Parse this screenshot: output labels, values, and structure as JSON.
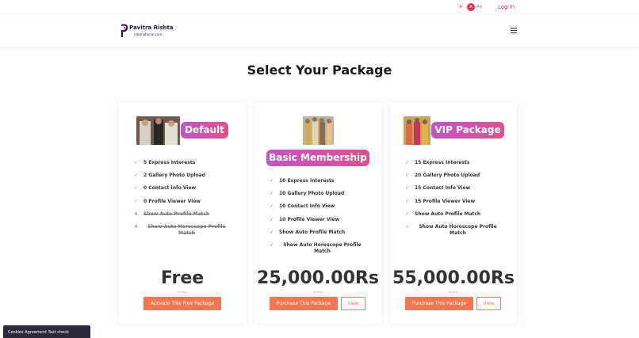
{
  "topbar": {
    "font_decrease": "A-",
    "font_normal": "A",
    "font_increase": "A+",
    "login": "Log In"
  },
  "header": {
    "logo_title": "Pavitra Rishta",
    "logo_subtitle": "international.com"
  },
  "page_title": "Select Your Package",
  "packages": [
    {
      "badge": "Default",
      "features": [
        {
          "text": "5 Express Interests",
          "included": true
        },
        {
          "text": "2 Gallery Photo Upload",
          "included": true
        },
        {
          "text": "0 Contact Info View",
          "included": true
        },
        {
          "text": "0 Profile Viewer View",
          "included": true
        },
        {
          "text": "Show Auto Profile Match",
          "included": false
        },
        {
          "text": "Show Auto Horoscope Profile Match",
          "included": false
        }
      ],
      "price": "Free",
      "duration": "10 Days",
      "purchase_label": "Activate This Free Package"
    },
    {
      "badge": "Basic Membership",
      "features": [
        {
          "text": "10 Express Interests",
          "included": true
        },
        {
          "text": "10 Gallery Photo Upload",
          "included": true
        },
        {
          "text": "10 Contact Info View",
          "included": true
        },
        {
          "text": "10 Profile Viewer View",
          "included": true
        },
        {
          "text": "Show Auto Profile Match",
          "included": true
        },
        {
          "text": "Show Auto Horoscope Profile Match",
          "included": true
        }
      ],
      "price": "25,000.00Rs",
      "duration": "30 Days",
      "purchase_label": "Purchase This Package",
      "view_label": "View"
    },
    {
      "badge": "VIP Package",
      "features": [
        {
          "text": "15 Express Interests",
          "included": true
        },
        {
          "text": "20 Gallery Photo Upload",
          "included": true
        },
        {
          "text": "15 Contact Info View",
          "included": true
        },
        {
          "text": "15 Profile Viewer View",
          "included": true
        },
        {
          "text": "Show Auto Profile Match",
          "included": true
        },
        {
          "text": "Show Auto Horoscope Profile Match",
          "included": true
        }
      ],
      "price": "55,000.00Rs",
      "duration": "90 Days",
      "purchase_label": "Purchase This Package",
      "view_label": "View"
    }
  ],
  "cookie_bar": "Cookies Agreement Text check",
  "colors": {
    "accent": "#e0365a",
    "button": "#f27654",
    "check": "#5cb85c",
    "badge_gradient_start": "#c155c8",
    "badge_gradient_end": "#e0508e"
  }
}
